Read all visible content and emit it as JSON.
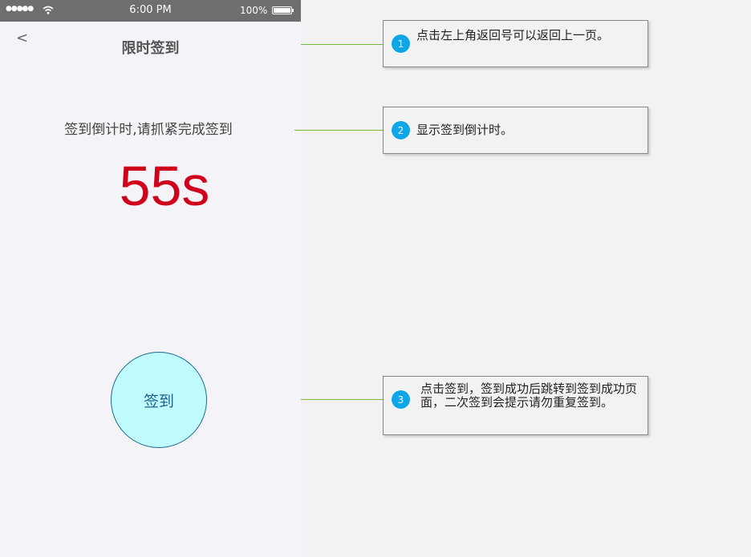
{
  "status_bar": {
    "signal": "●●●●●",
    "time": "6:00 PM",
    "battery": "100%"
  },
  "nav": {
    "back_label": "<",
    "title": "限时签到"
  },
  "countdown": {
    "tip": "签到倒计时,请抓紧完成签到",
    "value": "55s"
  },
  "checkin": {
    "label": "签到"
  },
  "annotations": [
    {
      "number": "1",
      "text": "点击左上角返回号可以返回上一页。"
    },
    {
      "number": "2",
      "text": "显示签到倒计时。"
    },
    {
      "number": "3",
      "text": "点击签到，签到成功后跳转到签到成功页面，二次签到会提示请勿重复签到。"
    }
  ],
  "colors": {
    "status_bar": "#6e6e6e",
    "countdown": "#d0021b",
    "checkin_fill": "#c0fbff",
    "badge": "#0fa6e8",
    "connector": "#78b63e"
  }
}
